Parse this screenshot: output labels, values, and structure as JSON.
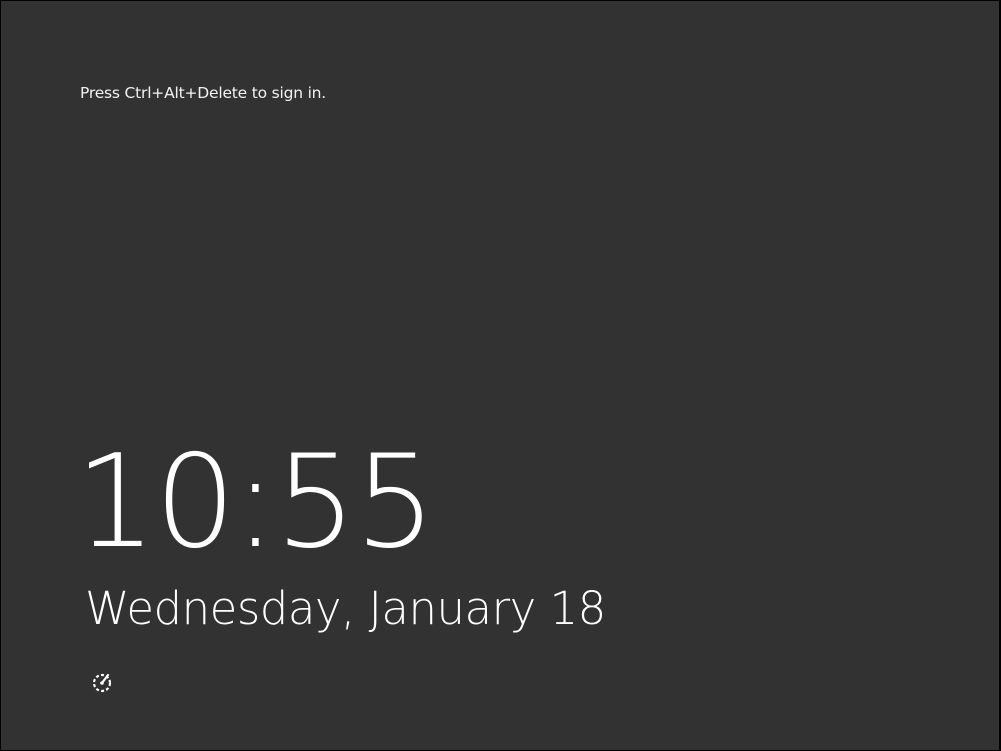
{
  "lock_screen": {
    "prompt": "Press Ctrl+Alt+Delete to sign in.",
    "time": "10:55",
    "date": "Wednesday, January 18",
    "ease_of_access_icon": "ease-of-access-icon"
  },
  "colors": {
    "background": "#323232",
    "text": "#ffffff"
  }
}
